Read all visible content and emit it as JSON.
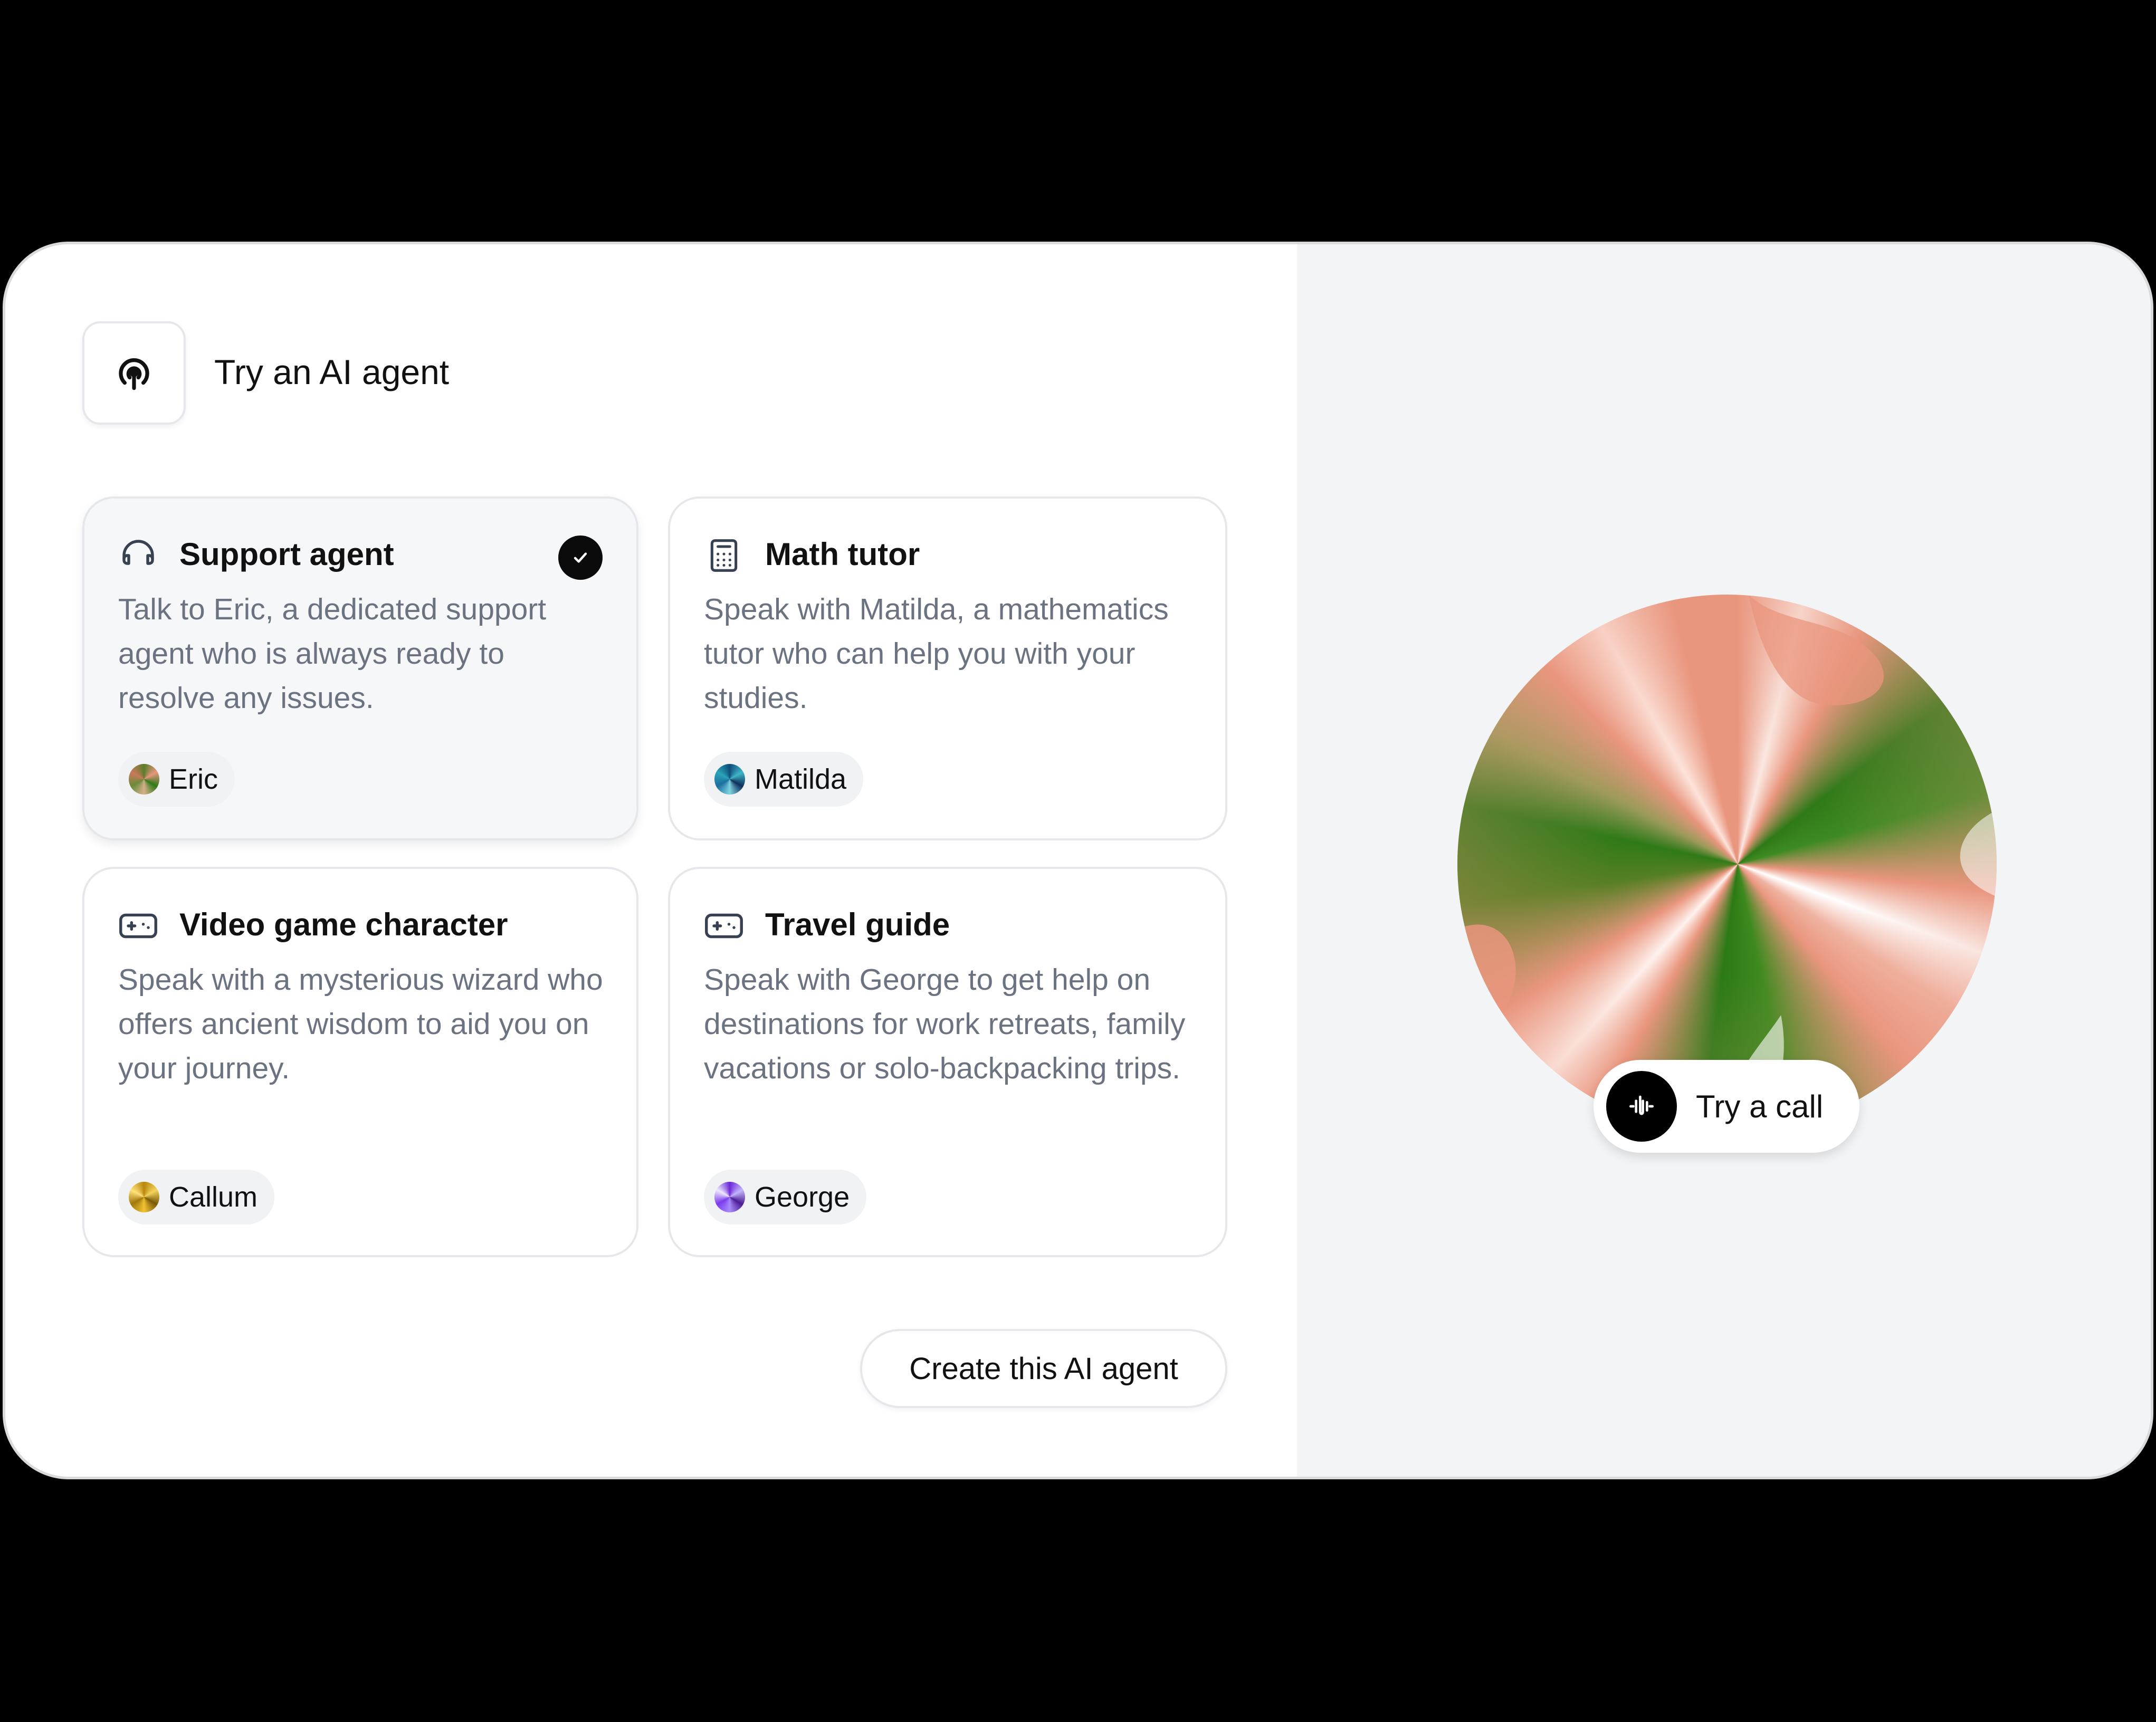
{
  "header": {
    "icon": "podcast-broadcast-icon",
    "title": "Try an AI agent"
  },
  "agents": [
    {
      "title": "Support agent",
      "icon": "headphones-icon",
      "description": "Talk to Eric, a dedicated support agent who is always ready to resolve any issues.",
      "voice": "Eric",
      "selected": true
    },
    {
      "title": "Math tutor",
      "icon": "calculator-icon",
      "description": "Speak with Matilda, a mathematics tutor who can help you with your studies.",
      "voice": "Matilda",
      "selected": false
    },
    {
      "title": "Video game character",
      "icon": "gamepad-icon",
      "description": "Speak with a mysterious wizard who offers ancient wisdom to aid you on your journey.",
      "voice": "Callum",
      "selected": false
    },
    {
      "title": "Travel guide",
      "icon": "gamepad-icon",
      "description": "Speak with George to get help on destinations for work retreats, family vacations or solo-backpacking trips.",
      "voice": "George",
      "selected": false
    }
  ],
  "actions": {
    "create_label": "Create this AI agent",
    "call_label": "Try a call",
    "call_icon": "waveform-icon"
  },
  "colors": {
    "orb_green": "#2f7a18",
    "orb_salmon": "#e9967e",
    "right_pane_bg": "#f3f4f6",
    "selected_card_bg": "#f6f7f9"
  }
}
